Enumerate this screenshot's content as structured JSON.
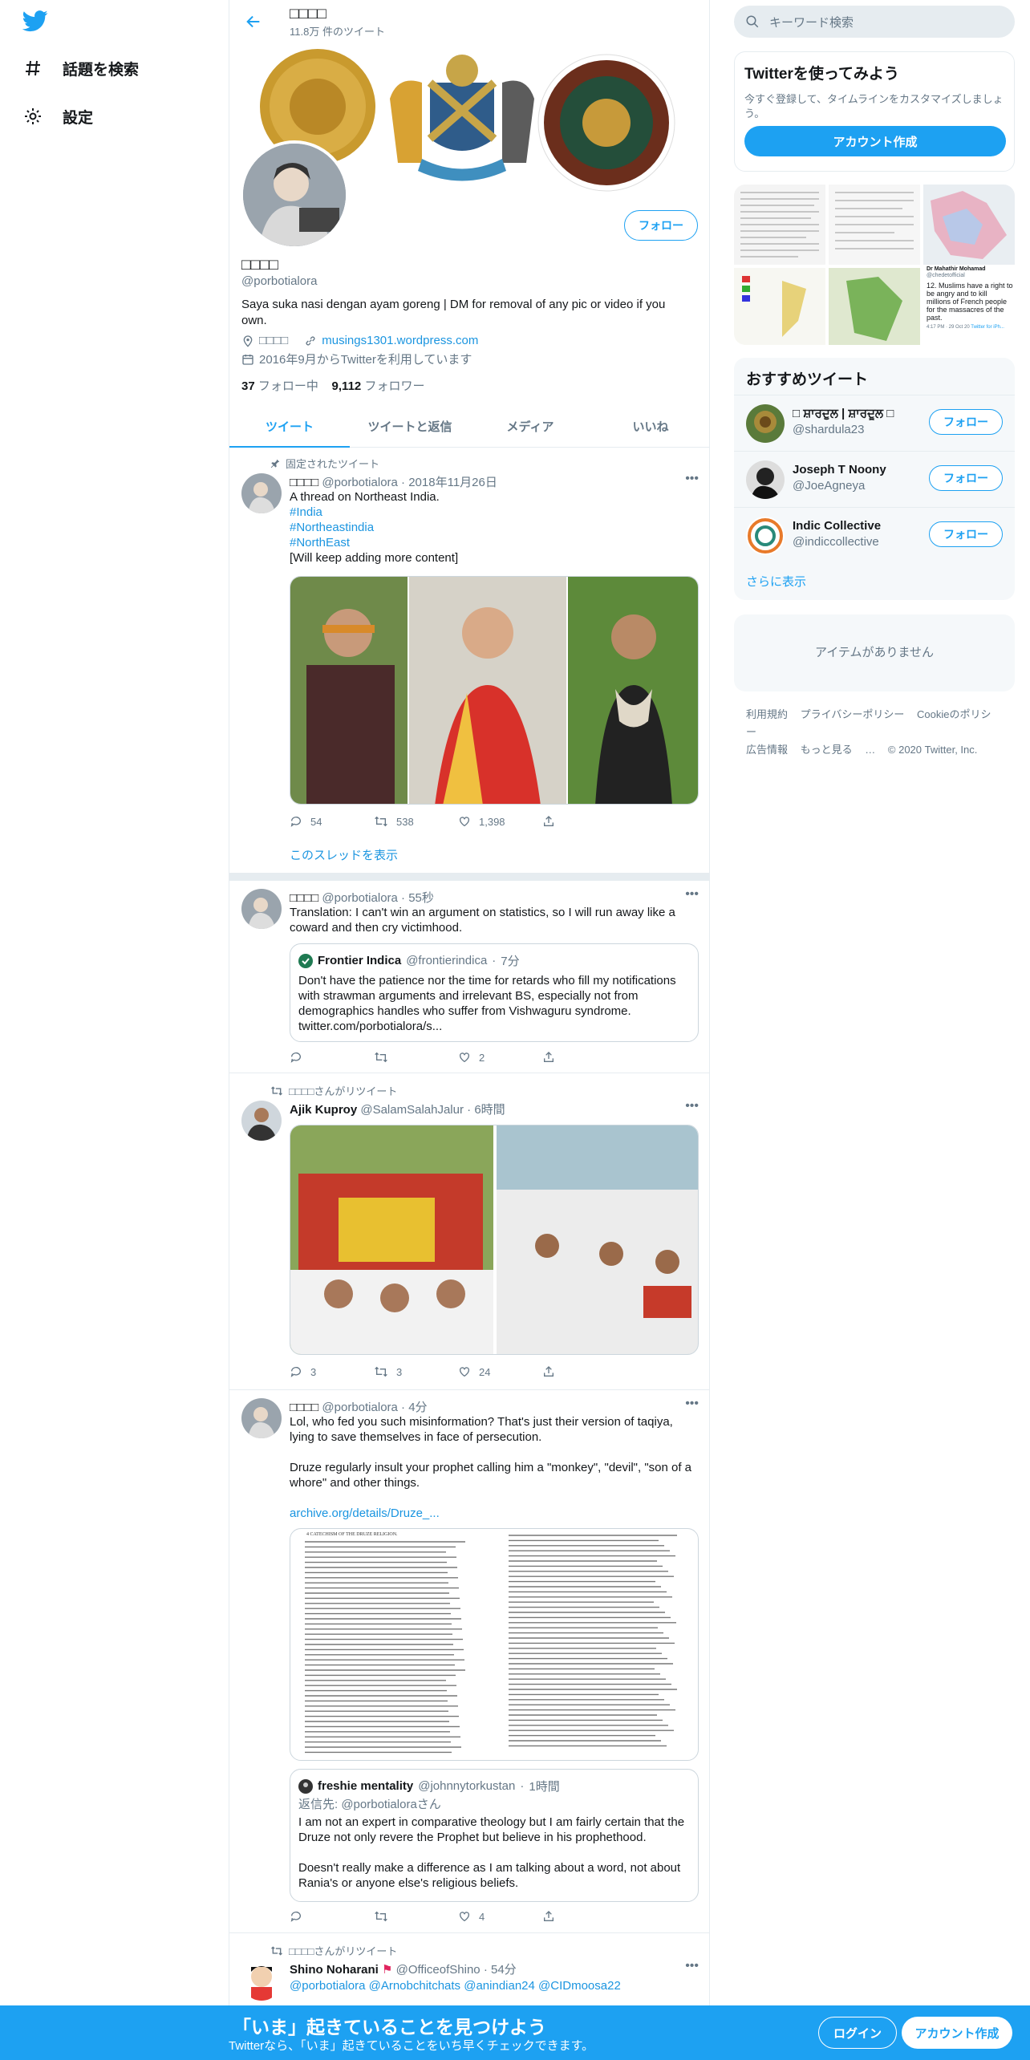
{
  "colors": {
    "accent": "#1da1f2",
    "text": "#14171a",
    "muted": "#657786",
    "border": "#e6ecf0"
  },
  "nav": {
    "logo_icon": "twitter-bird-icon",
    "items": [
      {
        "label": "話題を検索",
        "icon": "hashtag-icon"
      },
      {
        "label": "設定",
        "icon": "gear-icon"
      }
    ]
  },
  "header": {
    "name": "□□□□",
    "tweet_count": "11.8万 件のツイート"
  },
  "profile": {
    "follow_label": "フォロー",
    "name": "□□□□",
    "handle": "@porbotialora",
    "bio": "Saya suka nasi dengan ayam goreng | DM for removal of any pic or video if you own.",
    "location": "□□□□",
    "website": "musings1301.wordpress.com",
    "joined": "2016年9月からTwitterを利用しています",
    "following_count": "37",
    "following_label": "フォロー中",
    "followers_count": "9,112",
    "followers_label": "フォロワー"
  },
  "tabs": [
    "ツイート",
    "ツイートと返信",
    "メディア",
    "いいね"
  ],
  "tweets": [
    {
      "context": "固定されたツイート",
      "name": "□□□□",
      "handle": "@porbotialora",
      "time": "2018年11月26日",
      "lines": [
        "A thread on Northeast India."
      ],
      "hashtags": [
        "#India",
        "#Northeastindia",
        "#NorthEast"
      ],
      "text_after": "[Will keep adding more content]",
      "replies": "54",
      "retweets": "538",
      "likes": "1,398",
      "show_thread": "このスレッドを表示"
    },
    {
      "name": "□□□□",
      "handle": "@porbotialora",
      "time": "55秒",
      "text": "Translation: I can't win an argument on statistics, so I will run away like a coward and then cry victimhood.",
      "quote": {
        "name": "Frontier Indica",
        "handle": "@frontierindica",
        "time": "7分",
        "text": "Don't have the patience nor the time for retards who fill my notifications with strawman arguments and irrelevant BS, especially not from demographics handles who suffer from Vishwaguru syndrome.",
        "link": "twitter.com/porbotialora/s..."
      },
      "replies": "",
      "retweets": "",
      "likes": "2"
    },
    {
      "context": "□□□□さんがリツイート",
      "name": "Ajik Kuproy",
      "handle": "@SalamSalahJalur",
      "time": "6時間",
      "replies": "3",
      "retweets": "3",
      "likes": "24"
    },
    {
      "name": "□□□□",
      "handle": "@porbotialora",
      "time": "4分",
      "text1": "Lol, who fed you such misinformation? That's just their version of taqiya, lying to save themselves in face of persecution.",
      "text2": "Druze regularly insult your prophet calling him a \"monkey\", \"devil\", \"son of a whore\" and other things.",
      "link": "archive.org/details/Druze_...",
      "doc_heading": "4 CATECHISM OF THE DRUZE RELIGION.",
      "quote": {
        "name": "freshie mentality",
        "handle": "@johnnytorkustan",
        "time": "1時間",
        "reply_to": "返信先: @porbotialoraさん",
        "text1": "I am not an expert in comparative theology but I am fairly certain that the Druze not only revere the Prophet but believe in his prophethood.",
        "text2": "Doesn't really make a difference as I am talking about a word, not about Rania's or anyone else's religious beliefs."
      },
      "replies": "",
      "retweets": "",
      "likes": "4"
    },
    {
      "context": "□□□□さんがリツイート",
      "name": "Shino Noharani",
      "handle": "@OfficeofShino",
      "time": "54分",
      "mentions": "@porbotialora @Arnobchitchats @anindian24 @CIDmoosa22"
    }
  ],
  "sidebar": {
    "search_placeholder": "キーワード検索",
    "promo": {
      "title": "Twitterを使ってみよう",
      "subtitle": "今すぐ登録して、タイムラインをカスタマイズしましょう。",
      "button": "アカウント作成"
    },
    "media_caption_name": "Dr Mahathir Mohamad",
    "media_caption_handle": "@chedetofficial",
    "media_caption_text": "12. Muslims have a right to be angry and to kill millions of French people for the massacres of the past.",
    "media_caption_time": "4:17 PM · 29 Oct 20",
    "media_caption_source": "Twitter for iPh...",
    "who": {
      "title": "おすすめツイート",
      "items": [
        {
          "name": "□ ਸ਼ਾਰਦੁਲ | ਸ਼ਾਰਦੂਲ □",
          "handle": "@shardula23",
          "follow": "フォロー"
        },
        {
          "name": "Joseph T Noony",
          "handle": "@JoeAgneya",
          "follow": "フォロー"
        },
        {
          "name": "Indic Collective",
          "handle": "@indiccollective",
          "follow": "フォロー"
        }
      ],
      "show_more": "さらに表示"
    },
    "empty": "アイテムがありません",
    "footer": [
      "利用規約",
      "プライバシーポリシー",
      "Cookieのポリシー",
      "広告情報",
      "もっと見る",
      "© 2020 Twitter, Inc."
    ]
  },
  "bottom_bar": {
    "title": "「いま」起きていることを見つけよう",
    "subtitle": "Twitterなら、「いま」起きていることをいち早くチェックできます。",
    "login": "ログイン",
    "signup": "アカウント作成"
  }
}
